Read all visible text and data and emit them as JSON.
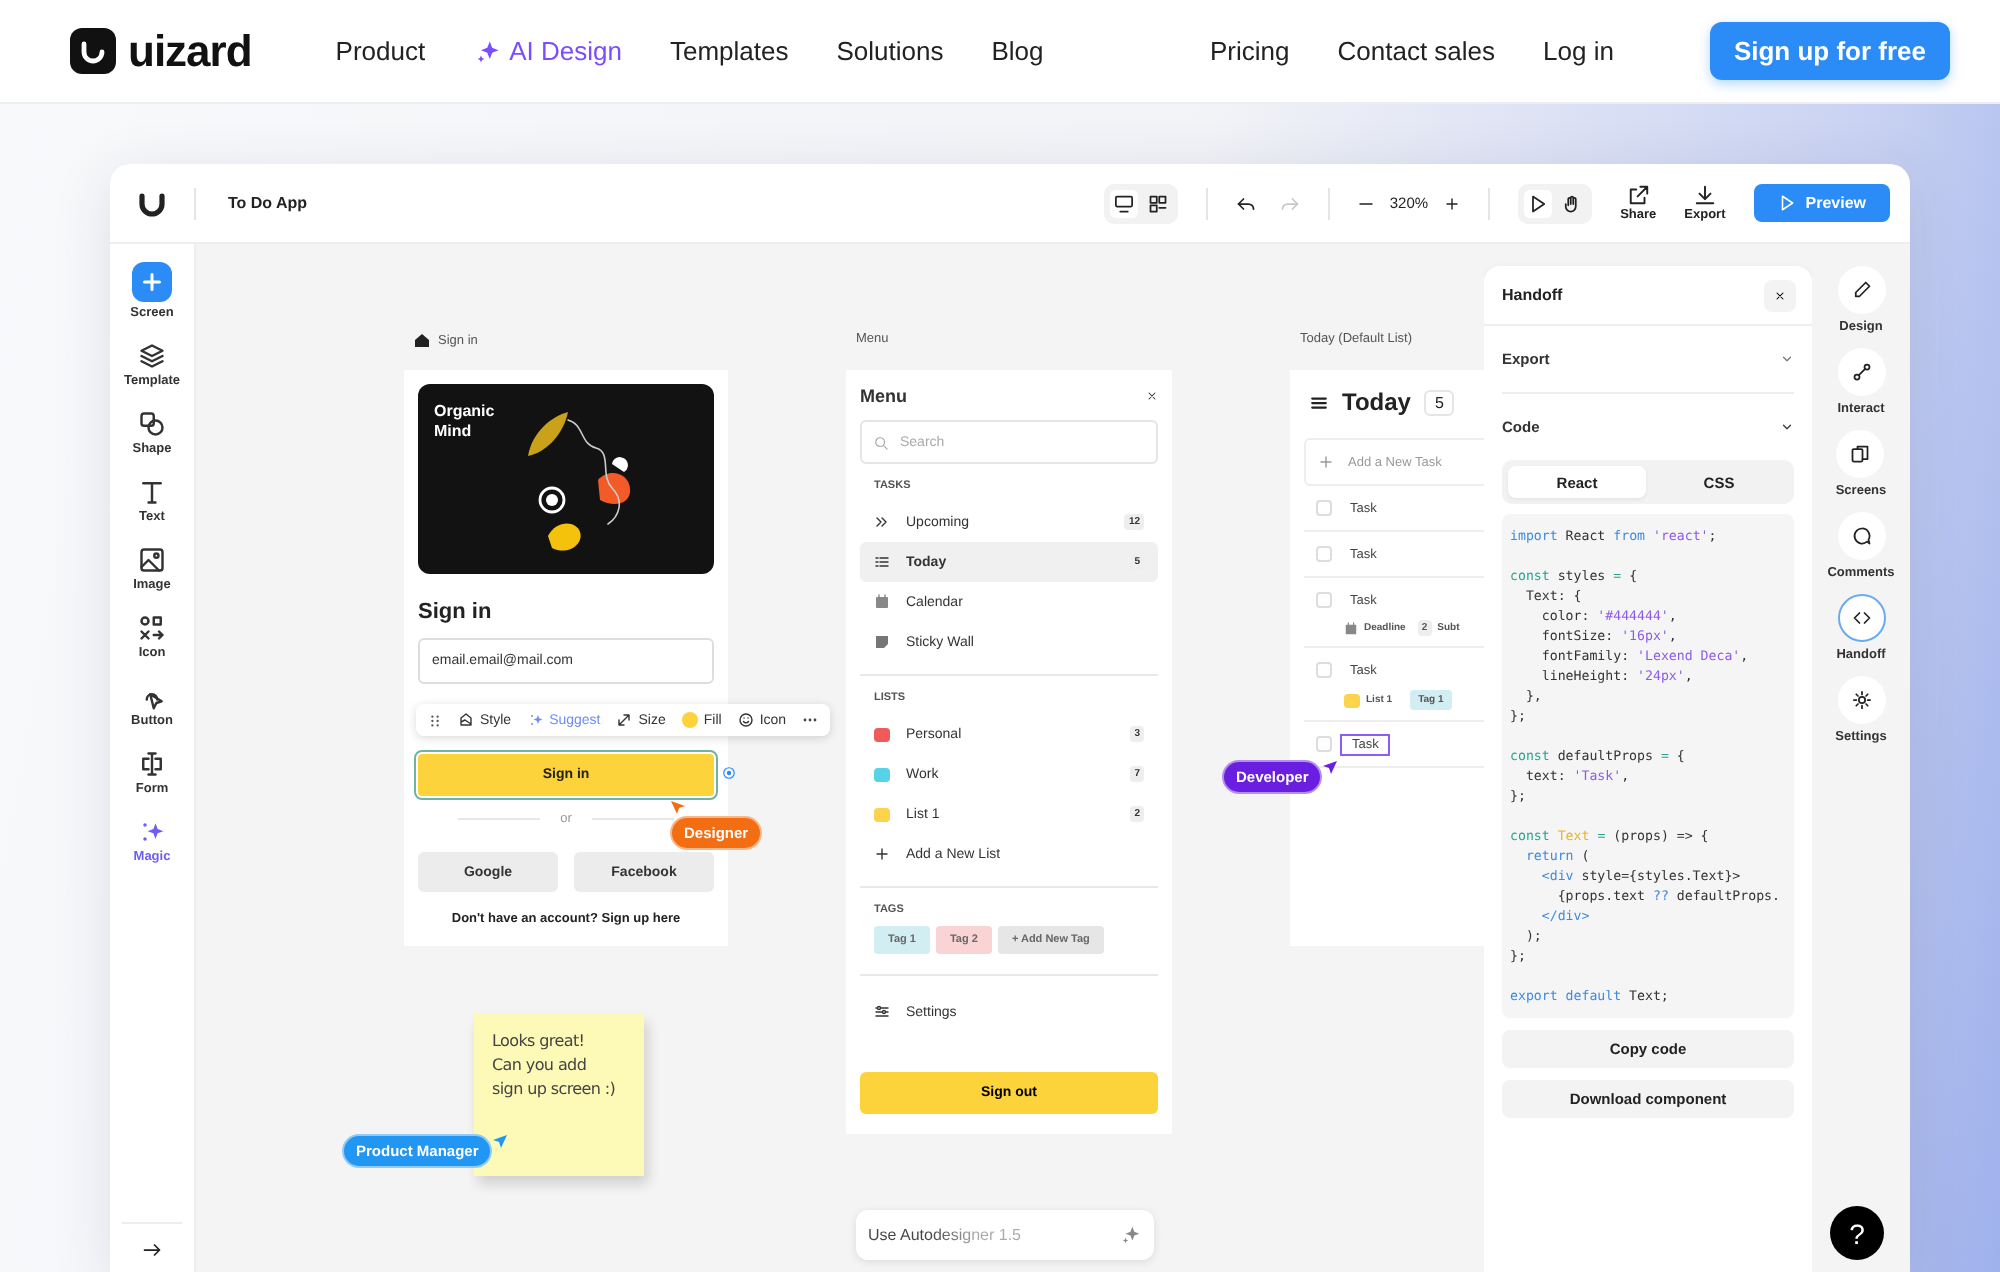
{
  "nav": {
    "logo": "uizard",
    "links": [
      {
        "label": "Product",
        "kind": "plain"
      },
      {
        "label": "AI Design",
        "kind": "ai"
      },
      {
        "label": "Templates",
        "kind": "plain"
      },
      {
        "label": "Solutions",
        "kind": "plain"
      },
      {
        "label": "Blog",
        "kind": "plain"
      }
    ],
    "right_links": [
      {
        "label": "Pricing"
      },
      {
        "label": "Contact sales"
      },
      {
        "label": "Log in"
      }
    ],
    "cta": "Sign up for free"
  },
  "app_header": {
    "project": "To Do App",
    "view_modes": [
      {
        "selected": true
      },
      {
        "selected": false
      }
    ],
    "interaction_modes": [
      {
        "selected": true
      },
      {
        "selected": false
      }
    ],
    "undo": {
      "disabled": false
    },
    "redo": {
      "disabled": true
    },
    "zoom": "320%",
    "actions": [
      {
        "label": "Share"
      },
      {
        "label": "Export"
      }
    ],
    "preview": "Preview"
  },
  "tools": [
    {
      "label": "Screen",
      "kind": "primary"
    },
    {
      "label": "Template",
      "kind": "tool"
    },
    {
      "label": "Shape",
      "kind": "tool"
    },
    {
      "label": "Text",
      "kind": "tool"
    },
    {
      "label": "Image",
      "kind": "tool"
    },
    {
      "label": "Icon",
      "kind": "tool"
    },
    {
      "label": "Button",
      "kind": "tool"
    },
    {
      "label": "Form",
      "kind": "tool"
    },
    {
      "label": "Magic",
      "kind": "magic"
    }
  ],
  "canvas": {
    "signin": {
      "label": "Sign in",
      "image_caption": "Organic Mind",
      "title": "Sign in",
      "email": "email.email@mail.com",
      "button": {
        "label": "Sign in",
        "selected": true
      },
      "divider": "or",
      "social": [
        "Google",
        "Facebook"
      ],
      "footer": "Don't have an account? Sign up here"
    },
    "element_toolbar": [
      {
        "label": "Style",
        "kind": "plain"
      },
      {
        "label": "Suggest",
        "kind": "ai"
      },
      {
        "label": "Size",
        "kind": "plain"
      },
      {
        "label": "Fill",
        "kind": "fill"
      },
      {
        "label": "Icon",
        "kind": "plain"
      }
    ],
    "menu": {
      "label": "Menu",
      "title": "Menu",
      "search": {
        "placeholder": "Search"
      },
      "tasks_heading": "TASKS",
      "tasks": [
        {
          "label": "Upcoming",
          "count": "12",
          "selected": false
        },
        {
          "label": "Today",
          "count": "5",
          "selected": true
        },
        {
          "label": "Calendar",
          "selected": false
        },
        {
          "label": "Sticky Wall",
          "selected": false
        }
      ],
      "lists_heading": "LISTS",
      "lists": [
        {
          "label": "Personal",
          "count": "3",
          "color": "#ef5b5b",
          "selected": false
        },
        {
          "label": "Work",
          "count": "7",
          "color": "#56d3e6",
          "selected": false
        },
        {
          "label": "List 1",
          "count": "2",
          "color": "#fcd34d",
          "selected": false
        }
      ],
      "add_list": "Add a New List",
      "tags_heading": "TAGS",
      "tags": [
        {
          "label": "Tag 1",
          "color": "#d3eef2"
        },
        {
          "label": "Tag 2",
          "color": "#fad4d4"
        }
      ],
      "add_tag": "+ Add New Tag",
      "settings": "Settings",
      "sign_out": "Sign out"
    },
    "today": {
      "label": "Today (Default List)",
      "title": "Today",
      "count": "5",
      "add_task": {
        "placeholder": "Add a New Task"
      },
      "tasks": [
        {
          "label": "Task",
          "checked": false,
          "selected": false
        },
        {
          "label": "Task",
          "checked": false,
          "selected": false
        },
        {
          "label": "Task",
          "checked": false,
          "selected": false,
          "deadline": "Deadline",
          "subtasks_count": "2",
          "subtasks": "Subt"
        },
        {
          "label": "Task",
          "checked": false,
          "selected": false,
          "list": {
            "label": "List 1",
            "color": "#fcd34d"
          },
          "tag": {
            "label": "Tag 1",
            "color": "#d3eef2"
          }
        },
        {
          "label": "Task",
          "checked": false,
          "selected": true
        }
      ]
    },
    "cursors": [
      {
        "name": "Designer",
        "color": "#f36d12"
      },
      {
        "name": "Developer",
        "color": "#6a1fe0"
      },
      {
        "name": "Product Manager",
        "color": "#2196f3"
      }
    ],
    "sticky_note": {
      "lines": [
        "Looks great!",
        "Can you add",
        "sign up screen :)"
      ]
    },
    "autodesigner": "Use Autodesigner 1.5"
  },
  "handoff": {
    "title": "Handoff",
    "sections": [
      {
        "label": "Export",
        "expanded": false
      },
      {
        "label": "Code",
        "expanded": true
      }
    ],
    "tabs": [
      {
        "label": "React",
        "selected": true
      },
      {
        "label": "CSS",
        "selected": false
      }
    ],
    "code": [
      [
        [
          {
            "kind": "keyword",
            "text": "import"
          },
          {
            "kind": "plain",
            "text": " React "
          },
          {
            "kind": "keyword",
            "text": "from"
          },
          {
            "kind": "string",
            "text": " 'react'"
          },
          {
            "kind": "plain",
            "text": ";"
          }
        ]
      ],
      [
        [
          {
            "kind": "decl",
            "text": "const"
          },
          {
            "kind": "plain",
            "text": " styles "
          },
          {
            "kind": "decl",
            "text": "="
          },
          {
            "kind": "plain",
            "text": " {"
          }
        ],
        [
          {
            "kind": "plain",
            "text": "  Text: {"
          }
        ],
        [
          {
            "kind": "plain",
            "text": "    color: "
          },
          {
            "kind": "string",
            "text": "'#444444'"
          },
          {
            "kind": "plain",
            "text": ","
          }
        ],
        [
          {
            "kind": "plain",
            "text": "    fontSize: "
          },
          {
            "kind": "string",
            "text": "'16px'"
          },
          {
            "kind": "plain",
            "text": ","
          }
        ],
        [
          {
            "kind": "plain",
            "text": "    fontFamily: "
          },
          {
            "kind": "string",
            "text": "'Lexend Deca'"
          },
          {
            "kind": "plain",
            "text": ","
          }
        ],
        [
          {
            "kind": "plain",
            "text": "    lineHeight: "
          },
          {
            "kind": "string",
            "text": "'24px'"
          },
          {
            "kind": "plain",
            "text": ","
          }
        ],
        [
          {
            "kind": "plain",
            "text": "  },"
          }
        ],
        [
          {
            "kind": "plain",
            "text": "};"
          }
        ]
      ],
      [
        [
          {
            "kind": "decl",
            "text": "const"
          },
          {
            "kind": "plain",
            "text": " defaultProps "
          },
          {
            "kind": "decl",
            "text": "="
          },
          {
            "kind": "plain",
            "text": " {"
          }
        ],
        [
          {
            "kind": "plain",
            "text": "  text: "
          },
          {
            "kind": "string",
            "text": "'Task'"
          },
          {
            "kind": "plain",
            "text": ","
          }
        ],
        [
          {
            "kind": "plain",
            "text": "};"
          }
        ]
      ],
      [
        [
          {
            "kind": "decl",
            "text": "const"
          },
          {
            "kind": "name",
            "text": " Text "
          },
          {
            "kind": "decl",
            "text": "="
          },
          {
            "kind": "plain",
            "text": " (props) => {"
          }
        ],
        [
          {
            "kind": "keyword",
            "text": "  return"
          },
          {
            "kind": "plain",
            "text": " ("
          }
        ],
        [
          {
            "kind": "keyword",
            "text": "    <div"
          },
          {
            "kind": "plain",
            "text": " style={styles.Text}>"
          }
        ],
        [
          {
            "kind": "plain",
            "text": "      {props.text "
          },
          {
            "kind": "keyword",
            "text": "??"
          },
          {
            "kind": "plain",
            "text": " defaultProps."
          }
        ],
        [
          {
            "kind": "keyword",
            "text": "    </div>"
          }
        ],
        [
          {
            "kind": "plain",
            "text": "  );"
          }
        ],
        [
          {
            "kind": "plain",
            "text": "};"
          }
        ]
      ],
      [
        [
          {
            "kind": "keyword",
            "text": "export default"
          },
          {
            "kind": "plain",
            "text": " Text;"
          }
        ]
      ]
    ],
    "buttons": [
      "Copy code",
      "Download component"
    ]
  },
  "rail": [
    {
      "label": "Design",
      "selected": false
    },
    {
      "label": "Interact",
      "selected": false
    },
    {
      "label": "Screens",
      "selected": false
    },
    {
      "label": "Comments",
      "selected": false
    },
    {
      "label": "Handoff",
      "selected": true
    },
    {
      "label": "Settings",
      "selected": false
    }
  ],
  "help": "?"
}
